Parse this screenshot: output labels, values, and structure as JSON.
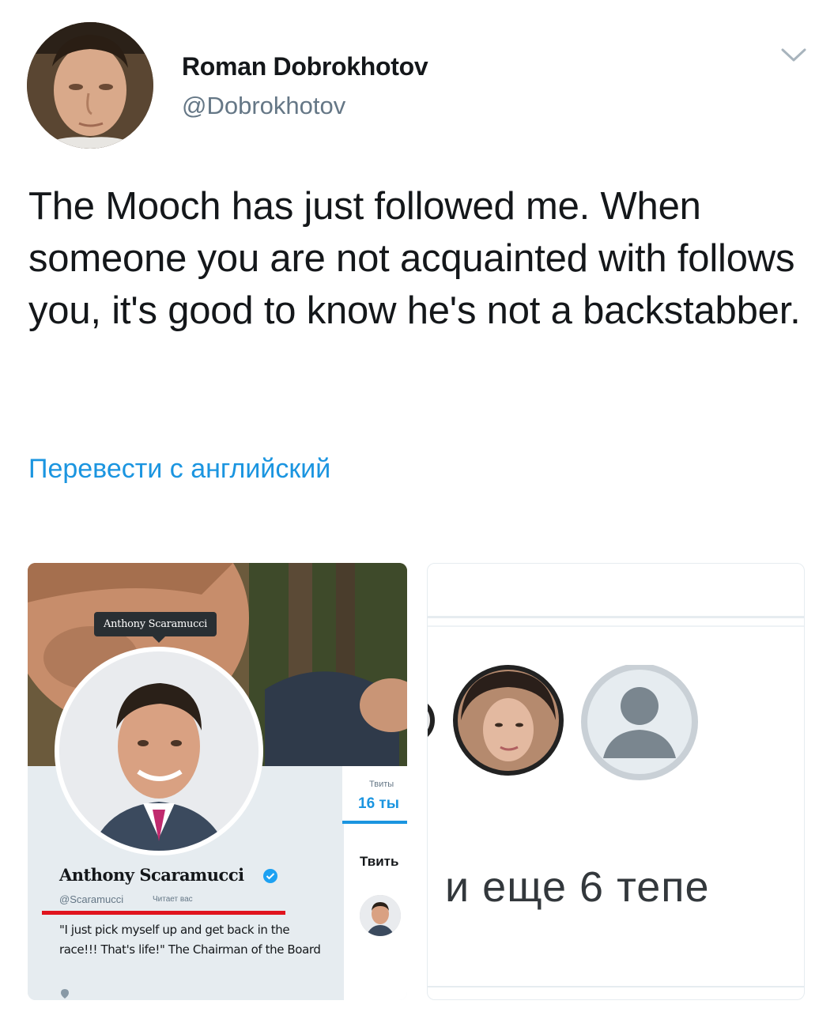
{
  "author": {
    "name": "Roman Dobrokhotov",
    "handle": "@Dobrokhotov"
  },
  "tweet": {
    "text": "The Mooch has just followed me. When someone you are not acquainted with follows you, it's good to know he's not a backstabber.",
    "translate_link": "Перевести с английский"
  },
  "media_left": {
    "tooltip": "Anthony Scaramucci",
    "profile_name": "Anthony Scaramucci",
    "profile_handle": "@Scaramucci",
    "follows_you": "Читает вас",
    "bio": "\"I just pick myself up and get back in the race!!! That's life!\" The Chairman of the Board",
    "stat_label": "Твиты",
    "stat_value": "16 ты",
    "tweets_heading": "Твить"
  },
  "media_right": {
    "text": "и еще 6 тепе"
  },
  "colors": {
    "link": "#1b95e0",
    "red_underline": "#e0141e",
    "verified": "#1da1f2"
  },
  "icons": [
    "chevron-down-icon",
    "verified-badge-icon",
    "location-icon"
  ]
}
